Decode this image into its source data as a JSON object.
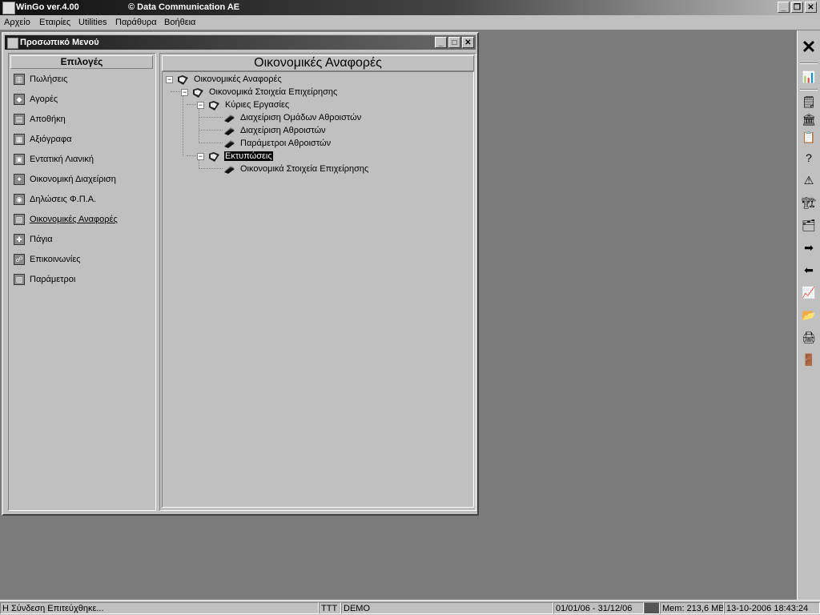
{
  "app": {
    "title": "WinGo ver.4.00",
    "copyright": "© Data Communication AE",
    "controls": {
      "minimize": "_",
      "restore": "❐",
      "close": "✕"
    }
  },
  "menubar": {
    "items": [
      "Αρχείο",
      "Εταιρίες",
      "Utilities",
      "Παράθυρα",
      "Βοήθεια"
    ]
  },
  "window": {
    "title": "Προσωπικό Μενού",
    "controls": {
      "minimize": "_",
      "maximize": "□",
      "close": "✕"
    }
  },
  "sidebar": {
    "header": "Επιλογές",
    "items": [
      {
        "label": "Πωλήσεις",
        "icon": "sales-icon"
      },
      {
        "label": "Αγορές",
        "icon": "purchases-icon"
      },
      {
        "label": "Αποθήκη",
        "icon": "warehouse-icon"
      },
      {
        "label": "Αξιόγραφα",
        "icon": "securities-icon"
      },
      {
        "label": "Εντατική Λιανική",
        "icon": "retail-icon"
      },
      {
        "label": "Οικονομική Διαχείριση",
        "icon": "financial-management-icon"
      },
      {
        "label": "Δηλώσεις Φ.Π.Α.",
        "icon": "vat-icon"
      },
      {
        "label": "Οικονομικές Αναφορές",
        "icon": "financial-reports-icon"
      },
      {
        "label": "Πάγια",
        "icon": "fixed-assets-icon"
      },
      {
        "label": "Επικοινωνίες",
        "icon": "communications-icon"
      },
      {
        "label": "Παράμετροι",
        "icon": "parameters-icon"
      }
    ],
    "active_index": 7
  },
  "main": {
    "header": "Οικονομικές Αναφορές",
    "tree": {
      "root": "Οικονομικές Αναφορές",
      "child": "Οικονομικά Στοιχεία Επιχείρησης",
      "main_tasks": "Κύριες Εργασίες",
      "main_tasks_items": [
        "Διαχείριση Ομάδων Αθροιστών",
        "Διαχείριση Αθροιστών",
        "Παράμετροι Αθροιστών"
      ],
      "prints": "Εκτυπώσεις",
      "prints_items": [
        "Οικονομικά Στοιχεία Επιχείρησης"
      ],
      "collapse_glyph": "−"
    }
  },
  "toolbar": {
    "close_glyph": "✕",
    "buttons": [
      "📊",
      "🗒",
      "🏛",
      "📋",
      "?",
      "⚠",
      "🏗",
      "🗂",
      "➡",
      "⬅",
      "📈",
      "📂",
      "🖨",
      "🚪"
    ]
  },
  "statusbar": {
    "message": "Η Σύνδεση Επιτεύχθηκε...",
    "user": "TTT",
    "company": "DEMO",
    "period": "01/01/06 - 31/12/06",
    "memory": "Mem: 213,6 MB",
    "datetime": "13-10-2006 18:43:24"
  }
}
